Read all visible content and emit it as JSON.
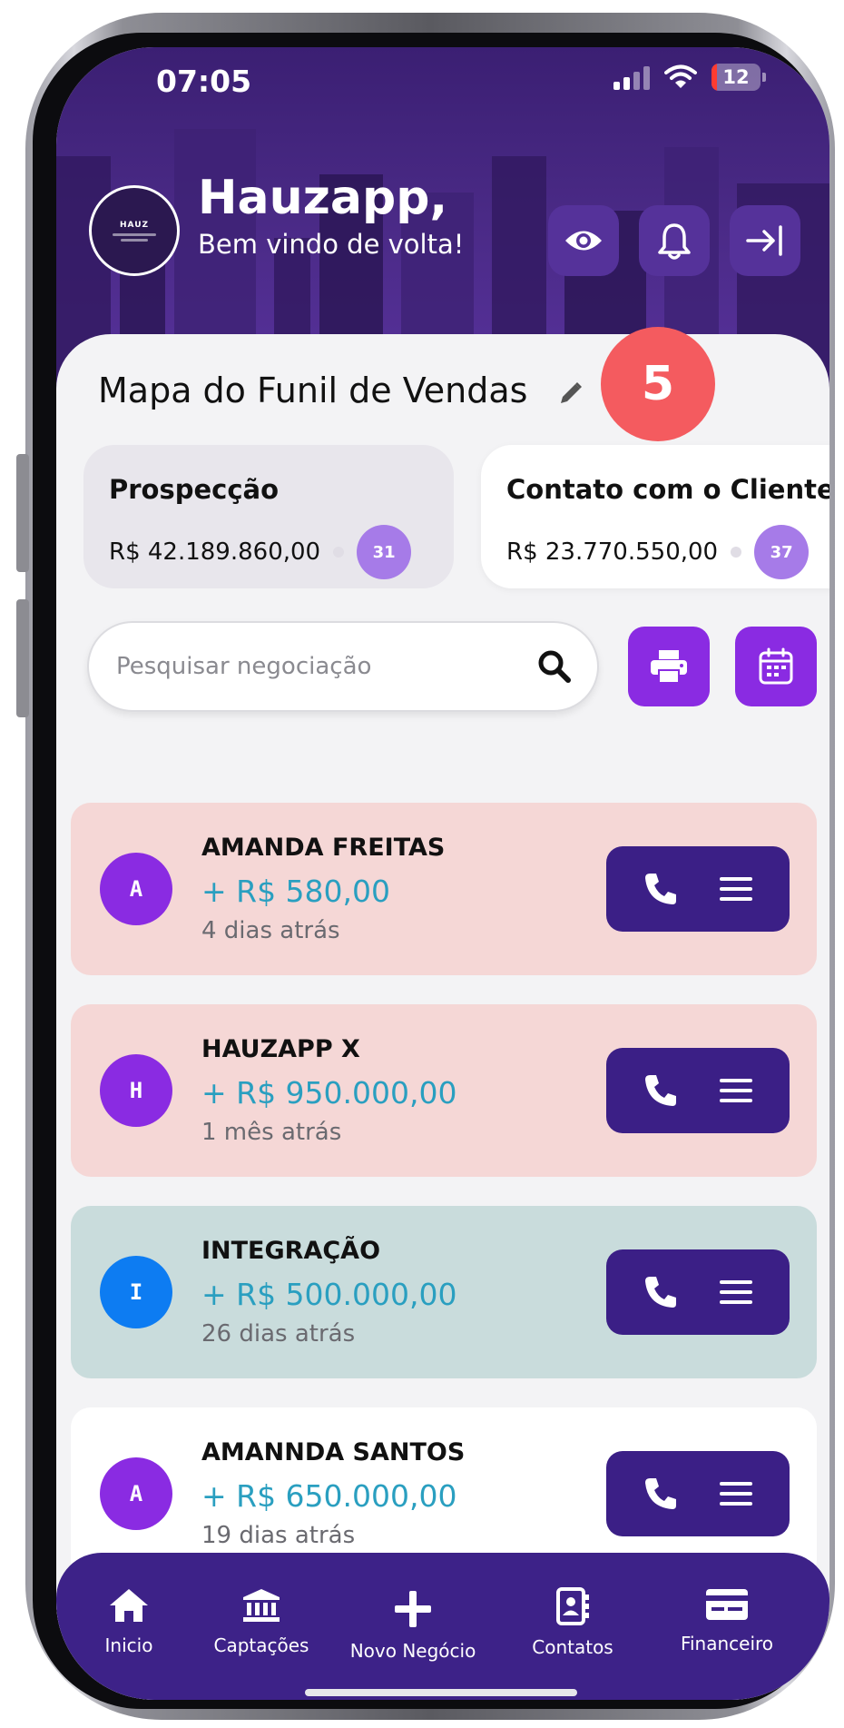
{
  "status_bar": {
    "time": "07:05",
    "battery": "12",
    "battery_level": 0.12
  },
  "header": {
    "logo_text": "HAUZ",
    "greeting_title": "Hauzapp,",
    "greeting_subtitle": "Bem vindo de volta!",
    "buttons": [
      "eye-icon",
      "bell-icon",
      "logout-icon"
    ]
  },
  "funnel": {
    "title": "Mapa do Funil de Vendas",
    "badge": "5",
    "stages": [
      {
        "name": "Prospecção",
        "value": "R$ 42.189.860,00",
        "count": "31"
      },
      {
        "name": "Contato com o Cliente",
        "value": "R$ 23.770.550,00",
        "count": "37"
      }
    ]
  },
  "search": {
    "placeholder": "Pesquisar negociação"
  },
  "leads": [
    {
      "initial": "A",
      "name": "AMANDA FREITAS",
      "value": "+ R$ 580,00",
      "time": "4 dias atrás",
      "bg": "#f5d7d6",
      "avatar": "#8a2be2"
    },
    {
      "initial": "H",
      "name": "HAUZAPP X",
      "value": "+ R$ 950.000,00",
      "time": "1 mês atrás",
      "bg": "#f5d7d6",
      "avatar": "#8a2be2"
    },
    {
      "initial": "I",
      "name": "INTEGRAÇÃO",
      "value": "+ R$ 500.000,00",
      "time": "26 dias atrás",
      "bg": "#c9dcdc",
      "avatar": "#0d7cf2"
    },
    {
      "initial": "A",
      "name": "AMANNDA SANTOS",
      "value": "+ R$ 650.000,00",
      "time": "19 dias atrás",
      "bg": "#ffffff",
      "avatar": "#8a2be2"
    }
  ],
  "nav": [
    {
      "label": "Inicio",
      "icon": "home-icon"
    },
    {
      "label": "Captações",
      "icon": "bank-icon"
    },
    {
      "label": "Novo Negócio",
      "icon": "plus-icon"
    },
    {
      "label": "Contatos",
      "icon": "contacts-icon"
    },
    {
      "label": "Financeiro",
      "icon": "card-icon"
    }
  ],
  "colors": {
    "primary": "#3d2288",
    "accent": "#8a2be2",
    "badge": "#f45b5f",
    "value_text": "#2a9fc0"
  }
}
